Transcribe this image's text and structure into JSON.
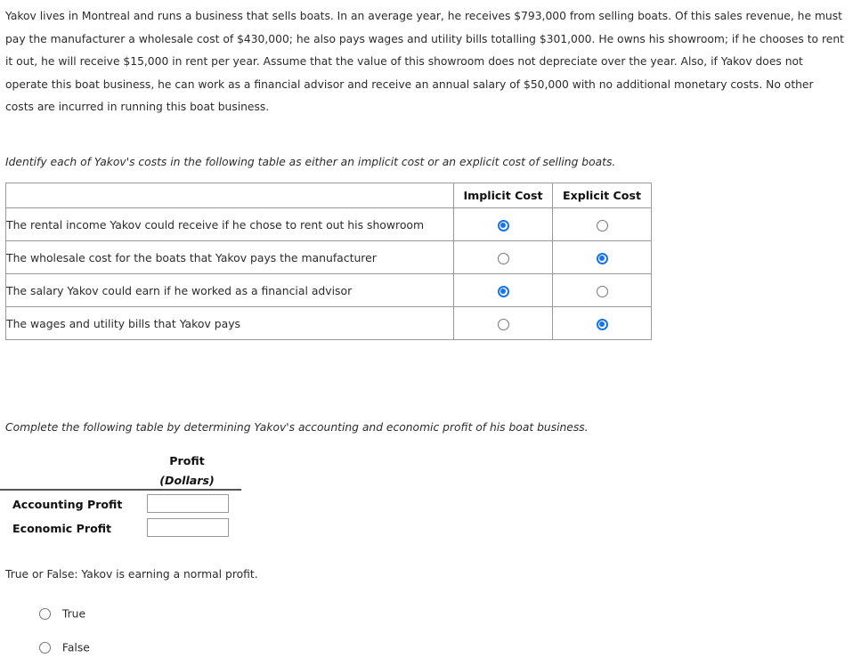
{
  "scenario": {
    "text": "Yakov lives in Montreal and runs a business that sells boats. In an average year, he receives $793,000 from selling boats. Of this sales revenue, he must pay the manufacturer a wholesale cost of $430,000; he also pays wages and utility bills totalling $301,000. He owns his showroom; if he chooses to rent it out, he will receive $15,000 in rent per year. Assume that the value of this showroom does not depreciate over the year. Also, if Yakov does not operate this boat business, he can work as a financial advisor and receive an annual salary of $50,000 with no additional monetary costs. No other costs are incurred in running this boat business."
  },
  "cost_section": {
    "prompt": "Identify each of Yakov's costs in the following table as either an implicit cost or an explicit cost of selling boats.",
    "columns": [
      "",
      "Implicit Cost",
      "Explicit Cost"
    ],
    "rows": [
      {
        "label": "The rental income Yakov could receive if he chose to rent out his showroom",
        "implicit_selected": true,
        "explicit_selected": false
      },
      {
        "label": "The wholesale cost for the boats that Yakov pays the manufacturer",
        "implicit_selected": false,
        "explicit_selected": true
      },
      {
        "label": "The salary Yakov could earn if he worked as a financial advisor",
        "implicit_selected": true,
        "explicit_selected": false
      },
      {
        "label": "The wages and utility bills that Yakov pays",
        "implicit_selected": false,
        "explicit_selected": true
      }
    ]
  },
  "profit_section": {
    "prompt": "Complete the following table by determining Yakov's accounting and economic profit of his boat business.",
    "header_line1": "Profit",
    "header_line2": "(Dollars)",
    "rows": [
      {
        "label": "Accounting Profit",
        "value": ""
      },
      {
        "label": "Economic Profit",
        "value": ""
      }
    ]
  },
  "true_false_section": {
    "question": "True or False: Yakov is earning a normal profit.",
    "options": [
      {
        "label": "True",
        "selected": false
      },
      {
        "label": "False",
        "selected": false
      }
    ]
  },
  "colors": {
    "selected_radio": "#1673e8",
    "unselected_radio_border": "#767676",
    "table_border": "#9a9a9a",
    "text": "#2b2b2b"
  }
}
